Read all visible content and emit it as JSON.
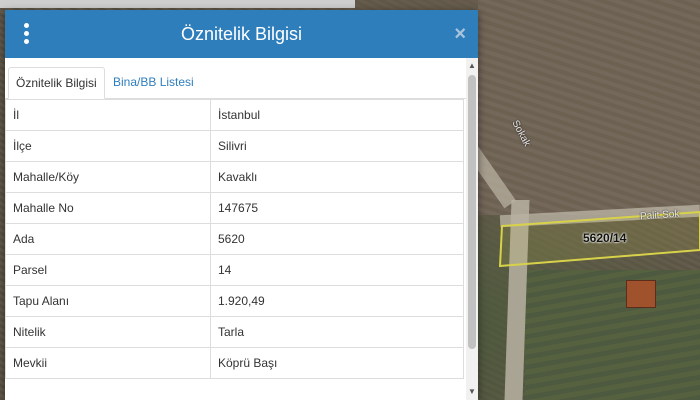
{
  "dialog": {
    "title": "Öznitelik Bilgisi",
    "close_glyph": "×",
    "tabs": [
      {
        "label": "Öznitelik Bilgisi",
        "active": true
      },
      {
        "label": "Bina/BB Listesi",
        "active": false
      }
    ],
    "rows": [
      {
        "key": "İl",
        "value": "İstanbul"
      },
      {
        "key": "İlçe",
        "value": "Silivri"
      },
      {
        "key": "Mahalle/Köy",
        "value": "Kavaklı"
      },
      {
        "key": "Mahalle No",
        "value": "147675"
      },
      {
        "key": "Ada",
        "value": "5620"
      },
      {
        "key": "Parsel",
        "value": "14"
      },
      {
        "key": "Tapu Alanı",
        "value": "1.920,49"
      },
      {
        "key": "Nitelik",
        "value": "Tarla"
      },
      {
        "key": "Mevkii",
        "value": "Köprü Başı"
      }
    ]
  },
  "map": {
    "parcel_label": "5620/14",
    "street_label_1": "Palit Sok",
    "street_label_2": "Sokak"
  },
  "icons": {
    "menu": "kebab-menu-icon",
    "close": "close-icon",
    "scroll_up": "triangle-up",
    "scroll_down": "triangle-down"
  },
  "colors": {
    "header": "#2f7ebc",
    "tab_link": "#2f7ebc",
    "parcel_outline": "#d8d24a"
  }
}
